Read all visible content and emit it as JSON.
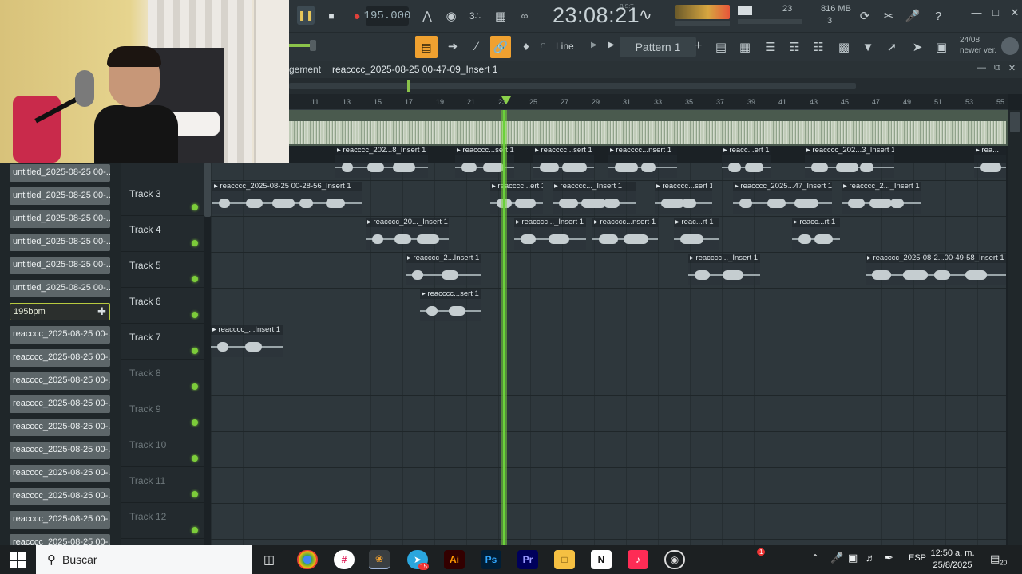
{
  "toolbar": {
    "tempo": "195.000",
    "clock": "23:08:21",
    "clock_sub": "B:S:T",
    "poly": "23",
    "ram": "816 MB",
    "ram_voices": "3",
    "news_date": "24/08",
    "news_text": "newer ver.",
    "pattern": "Pattern 1",
    "snap_mode": "Line"
  },
  "playlist": {
    "title_prefix": "gement",
    "title": "reacccc_2025-08-25 00-47-09_Insert 1",
    "ruler": [
      "11",
      "13",
      "15",
      "17",
      "19",
      "21",
      "23",
      "25",
      "27",
      "29",
      "31",
      "33",
      "35",
      "37",
      "39",
      "41",
      "43",
      "45",
      "47",
      "49",
      "51",
      "53",
      "55"
    ]
  },
  "browser": {
    "items": [
      "untitled_2025-08-25 00-...",
      "untitled_2025-08-25 00-...",
      "untitled_2025-08-25 00-...",
      "untitled_2025-08-25 00-...",
      "untitled_2025-08-25 00-...",
      "untitled_2025-08-25 00-...",
      "195bpm",
      "reacccc_2025-08-25 00-...",
      "reacccc_2025-08-25 00-...",
      "reacccc_2025-08-25 00-...",
      "reacccc_2025-08-25 00-...",
      "reacccc_2025-08-25 00-...",
      "reacccc_2025-08-25 00-...",
      "reacccc_2025-08-25 00-...",
      "reacccc_2025-08-25 00-...",
      "reacccc_2025-08-25 00-...",
      "reacccc_2025-08-25 00-..."
    ]
  },
  "tracks": [
    "Track 3",
    "Track 4",
    "Track 5",
    "Track 6",
    "Track 7",
    "Track 8",
    "Track 9",
    "Track 10",
    "Track 11",
    "Track 12"
  ],
  "clips": {
    "r2": [
      "reacccc_202...8_Insert 1",
      "reacccc...sert 1",
      "reacccc...sert 1",
      "reacccc...nsert 1",
      "reacc...ert 1",
      "reacccc_202...3_Insert 1",
      "rea..."
    ],
    "r3": [
      "reacccc_2025-08-25 00-28-56_Insert 1",
      "reacccc...ert 1",
      "reacccc..._Insert 1",
      "reacccc...sert 1",
      "reacccc_2025...47_Insert 1",
      "reacccc_2..._Insert 1"
    ],
    "r4": [
      "reacccc_20..._Insert 1",
      "reacccc..._Insert 1",
      "reacccc...nsert 1",
      "reac...rt 1",
      "reacc...rt 1"
    ],
    "r5": [
      "reacccc_2...Insert 1",
      "reacccc..._Insert 1",
      "reacccc_2025-08-2...00-49-58_Insert 1"
    ],
    "r6": [
      "reacccc...sert 1"
    ],
    "r7": [
      "reacccc_...Insert 1"
    ]
  },
  "taskbar": {
    "search_placeholder": "Buscar",
    "lang": "ESP",
    "time": "12:50 a. m.",
    "date": "25/8/2025",
    "notif_count": "20",
    "telegram_badge": "15",
    "tray_badge": "1",
    "apps": {
      "ai": "Ai",
      "ps": "Ps",
      "pr": "Pr",
      "notion": "N"
    }
  },
  "colors": {
    "accent_orange": "#f0a130",
    "playhead_green": "#6ad13a",
    "track_led": "#7ccc3a"
  }
}
